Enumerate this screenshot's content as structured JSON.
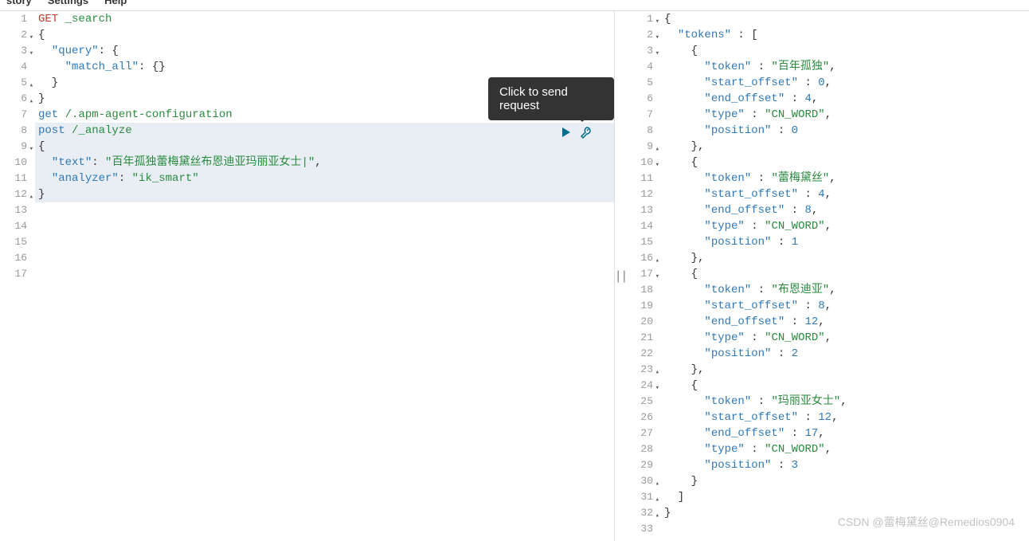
{
  "menu": {
    "history": "story",
    "settings": "Settings",
    "help": "Help"
  },
  "tooltip": "Click to send request",
  "divider_glyph": "||",
  "watermark": "CSDN @蕾梅黛丝@Remedios0904",
  "editor": {
    "lines": [
      {
        "n": 1,
        "fold": "",
        "hl": false,
        "segs": [
          [
            "kw-get",
            "GET"
          ],
          [
            "punct",
            " "
          ],
          [
            "path",
            "_search"
          ]
        ]
      },
      {
        "n": 2,
        "fold": "▾",
        "hl": false,
        "segs": [
          [
            "punct",
            "{"
          ]
        ]
      },
      {
        "n": 3,
        "fold": "▾",
        "hl": false,
        "segs": [
          [
            "punct",
            "  "
          ],
          [
            "key",
            "\"query\""
          ],
          [
            "punct",
            ": {"
          ]
        ]
      },
      {
        "n": 4,
        "fold": "",
        "hl": false,
        "segs": [
          [
            "punct",
            "    "
          ],
          [
            "key",
            "\"match_all\""
          ],
          [
            "punct",
            ": {}"
          ]
        ]
      },
      {
        "n": 5,
        "fold": "▴",
        "hl": false,
        "segs": [
          [
            "punct",
            "  }"
          ]
        ]
      },
      {
        "n": 6,
        "fold": "▴",
        "hl": false,
        "segs": [
          [
            "punct",
            "}"
          ]
        ]
      },
      {
        "n": 7,
        "fold": "",
        "hl": false,
        "segs": [
          [
            "kw-get2",
            "get"
          ],
          [
            "punct",
            " "
          ],
          [
            "path",
            "/.apm-agent-configuration"
          ]
        ]
      },
      {
        "n": 8,
        "fold": "",
        "hl": true,
        "segs": [
          [
            "kw-post",
            "post"
          ],
          [
            "punct",
            " "
          ],
          [
            "path",
            "/_analyze"
          ]
        ]
      },
      {
        "n": 9,
        "fold": "▾",
        "hl": true,
        "segs": [
          [
            "punct",
            "{"
          ]
        ]
      },
      {
        "n": 10,
        "fold": "",
        "hl": true,
        "segs": [
          [
            "punct",
            "  "
          ],
          [
            "key",
            "\"text\""
          ],
          [
            "punct",
            ": "
          ],
          [
            "str",
            "\"百年孤独蕾梅黛丝布恩迪亚玛丽亚女士|\""
          ],
          [
            "punct",
            ","
          ]
        ]
      },
      {
        "n": 11,
        "fold": "",
        "hl": true,
        "segs": [
          [
            "punct",
            "  "
          ],
          [
            "key",
            "\"analyzer\""
          ],
          [
            "punct",
            ": "
          ],
          [
            "str",
            "\"ik_smart\""
          ]
        ]
      },
      {
        "n": 12,
        "fold": "▴",
        "hl": true,
        "segs": [
          [
            "punct",
            "}"
          ]
        ]
      },
      {
        "n": 13,
        "fold": "",
        "hl": false,
        "segs": []
      },
      {
        "n": 14,
        "fold": "",
        "hl": false,
        "segs": []
      },
      {
        "n": 15,
        "fold": "",
        "hl": false,
        "segs": []
      },
      {
        "n": 16,
        "fold": "",
        "hl": false,
        "segs": []
      },
      {
        "n": 17,
        "fold": "",
        "hl": false,
        "segs": []
      }
    ]
  },
  "response": {
    "lines": [
      {
        "n": 1,
        "fold": "▾",
        "segs": [
          [
            "punct",
            "{"
          ]
        ]
      },
      {
        "n": 2,
        "fold": "▾",
        "segs": [
          [
            "punct",
            "  "
          ],
          [
            "key",
            "\"tokens\""
          ],
          [
            "punct",
            " : ["
          ]
        ]
      },
      {
        "n": 3,
        "fold": "▾",
        "segs": [
          [
            "punct",
            "    {"
          ]
        ]
      },
      {
        "n": 4,
        "fold": "",
        "segs": [
          [
            "punct",
            "      "
          ],
          [
            "key",
            "\"token\""
          ],
          [
            "punct",
            " : "
          ],
          [
            "str",
            "\"百年孤独\""
          ],
          [
            "punct",
            ","
          ]
        ]
      },
      {
        "n": 5,
        "fold": "",
        "segs": [
          [
            "punct",
            "      "
          ],
          [
            "key",
            "\"start_offset\""
          ],
          [
            "punct",
            " : "
          ],
          [
            "num",
            "0"
          ],
          [
            "punct",
            ","
          ]
        ]
      },
      {
        "n": 6,
        "fold": "",
        "segs": [
          [
            "punct",
            "      "
          ],
          [
            "key",
            "\"end_offset\""
          ],
          [
            "punct",
            " : "
          ],
          [
            "num",
            "4"
          ],
          [
            "punct",
            ","
          ]
        ]
      },
      {
        "n": 7,
        "fold": "",
        "segs": [
          [
            "punct",
            "      "
          ],
          [
            "key",
            "\"type\""
          ],
          [
            "punct",
            " : "
          ],
          [
            "str",
            "\"CN_WORD\""
          ],
          [
            "punct",
            ","
          ]
        ]
      },
      {
        "n": 8,
        "fold": "",
        "segs": [
          [
            "punct",
            "      "
          ],
          [
            "key",
            "\"position\""
          ],
          [
            "punct",
            " : "
          ],
          [
            "num",
            "0"
          ]
        ]
      },
      {
        "n": 9,
        "fold": "▴",
        "segs": [
          [
            "punct",
            "    },"
          ]
        ]
      },
      {
        "n": 10,
        "fold": "▾",
        "segs": [
          [
            "punct",
            "    {"
          ]
        ]
      },
      {
        "n": 11,
        "fold": "",
        "segs": [
          [
            "punct",
            "      "
          ],
          [
            "key",
            "\"token\""
          ],
          [
            "punct",
            " : "
          ],
          [
            "str",
            "\"蕾梅黛丝\""
          ],
          [
            "punct",
            ","
          ]
        ]
      },
      {
        "n": 12,
        "fold": "",
        "segs": [
          [
            "punct",
            "      "
          ],
          [
            "key",
            "\"start_offset\""
          ],
          [
            "punct",
            " : "
          ],
          [
            "num",
            "4"
          ],
          [
            "punct",
            ","
          ]
        ]
      },
      {
        "n": 13,
        "fold": "",
        "segs": [
          [
            "punct",
            "      "
          ],
          [
            "key",
            "\"end_offset\""
          ],
          [
            "punct",
            " : "
          ],
          [
            "num",
            "8"
          ],
          [
            "punct",
            ","
          ]
        ]
      },
      {
        "n": 14,
        "fold": "",
        "segs": [
          [
            "punct",
            "      "
          ],
          [
            "key",
            "\"type\""
          ],
          [
            "punct",
            " : "
          ],
          [
            "str",
            "\"CN_WORD\""
          ],
          [
            "punct",
            ","
          ]
        ]
      },
      {
        "n": 15,
        "fold": "",
        "segs": [
          [
            "punct",
            "      "
          ],
          [
            "key",
            "\"position\""
          ],
          [
            "punct",
            " : "
          ],
          [
            "num",
            "1"
          ]
        ]
      },
      {
        "n": 16,
        "fold": "▴",
        "segs": [
          [
            "punct",
            "    },"
          ]
        ]
      },
      {
        "n": 17,
        "fold": "▾",
        "segs": [
          [
            "punct",
            "    {"
          ]
        ]
      },
      {
        "n": 18,
        "fold": "",
        "segs": [
          [
            "punct",
            "      "
          ],
          [
            "key",
            "\"token\""
          ],
          [
            "punct",
            " : "
          ],
          [
            "str",
            "\"布恩迪亚\""
          ],
          [
            "punct",
            ","
          ]
        ]
      },
      {
        "n": 19,
        "fold": "",
        "segs": [
          [
            "punct",
            "      "
          ],
          [
            "key",
            "\"start_offset\""
          ],
          [
            "punct",
            " : "
          ],
          [
            "num",
            "8"
          ],
          [
            "punct",
            ","
          ]
        ]
      },
      {
        "n": 20,
        "fold": "",
        "segs": [
          [
            "punct",
            "      "
          ],
          [
            "key",
            "\"end_offset\""
          ],
          [
            "punct",
            " : "
          ],
          [
            "num",
            "12"
          ],
          [
            "punct",
            ","
          ]
        ]
      },
      {
        "n": 21,
        "fold": "",
        "segs": [
          [
            "punct",
            "      "
          ],
          [
            "key",
            "\"type\""
          ],
          [
            "punct",
            " : "
          ],
          [
            "str",
            "\"CN_WORD\""
          ],
          [
            "punct",
            ","
          ]
        ]
      },
      {
        "n": 22,
        "fold": "",
        "segs": [
          [
            "punct",
            "      "
          ],
          [
            "key",
            "\"position\""
          ],
          [
            "punct",
            " : "
          ],
          [
            "num",
            "2"
          ]
        ]
      },
      {
        "n": 23,
        "fold": "▴",
        "segs": [
          [
            "punct",
            "    },"
          ]
        ]
      },
      {
        "n": 24,
        "fold": "▾",
        "segs": [
          [
            "punct",
            "    {"
          ]
        ]
      },
      {
        "n": 25,
        "fold": "",
        "segs": [
          [
            "punct",
            "      "
          ],
          [
            "key",
            "\"token\""
          ],
          [
            "punct",
            " : "
          ],
          [
            "str",
            "\"玛丽亚女士\""
          ],
          [
            "punct",
            ","
          ]
        ]
      },
      {
        "n": 26,
        "fold": "",
        "segs": [
          [
            "punct",
            "      "
          ],
          [
            "key",
            "\"start_offset\""
          ],
          [
            "punct",
            " : "
          ],
          [
            "num",
            "12"
          ],
          [
            "punct",
            ","
          ]
        ]
      },
      {
        "n": 27,
        "fold": "",
        "segs": [
          [
            "punct",
            "      "
          ],
          [
            "key",
            "\"end_offset\""
          ],
          [
            "punct",
            " : "
          ],
          [
            "num",
            "17"
          ],
          [
            "punct",
            ","
          ]
        ]
      },
      {
        "n": 28,
        "fold": "",
        "segs": [
          [
            "punct",
            "      "
          ],
          [
            "key",
            "\"type\""
          ],
          [
            "punct",
            " : "
          ],
          [
            "str",
            "\"CN_WORD\""
          ],
          [
            "punct",
            ","
          ]
        ]
      },
      {
        "n": 29,
        "fold": "",
        "segs": [
          [
            "punct",
            "      "
          ],
          [
            "key",
            "\"position\""
          ],
          [
            "punct",
            " : "
          ],
          [
            "num",
            "3"
          ]
        ]
      },
      {
        "n": 30,
        "fold": "▴",
        "segs": [
          [
            "punct",
            "    }"
          ]
        ]
      },
      {
        "n": 31,
        "fold": "▴",
        "segs": [
          [
            "punct",
            "  ]"
          ]
        ]
      },
      {
        "n": 32,
        "fold": "▴",
        "segs": [
          [
            "punct",
            "}"
          ]
        ]
      },
      {
        "n": 33,
        "fold": "",
        "segs": []
      }
    ]
  }
}
